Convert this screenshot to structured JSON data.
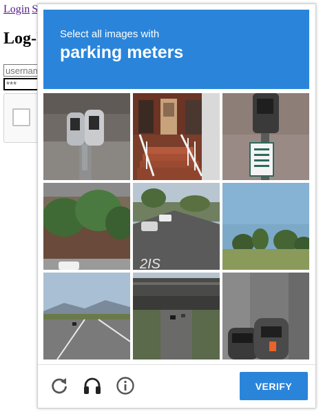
{
  "page": {
    "nav": {
      "login_link": "Login",
      "second_link": "S"
    },
    "heading": "Log-I",
    "username_placeholder": "usernam",
    "password_value": "***"
  },
  "challenge": {
    "prompt_line1": "Select all images with",
    "prompt_target": "parking meters",
    "verify_label": "VERIFY",
    "colors": {
      "accent": "#2a85da",
      "icon": "#555555"
    },
    "tiles": [
      {
        "subject": "parking meter close-up"
      },
      {
        "subject": "house porch with stairs"
      },
      {
        "subject": "parking meter and street sign"
      },
      {
        "subject": "building with trees"
      },
      {
        "subject": "street with parked cars",
        "ground_text": "2IS"
      },
      {
        "subject": "trees and sky"
      },
      {
        "subject": "highway with mountains"
      },
      {
        "subject": "highway under overpass"
      },
      {
        "subject": "parking meters"
      }
    ]
  }
}
